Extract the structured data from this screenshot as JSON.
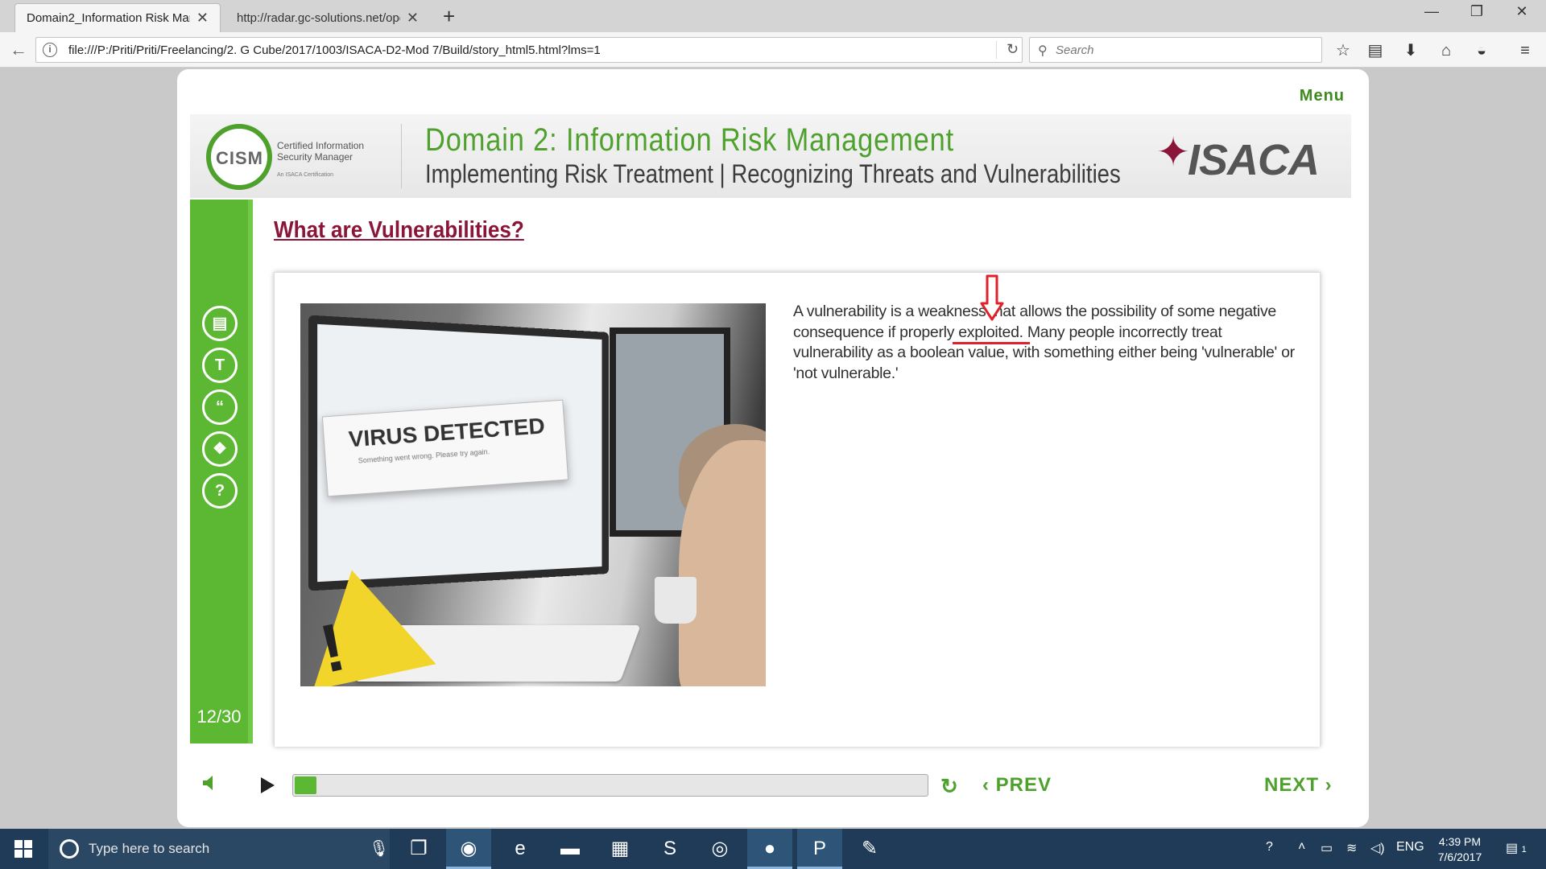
{
  "browser": {
    "tabs": [
      {
        "title": "Domain2_Information Risk Mana",
        "active": true
      },
      {
        "title": "http://radar.gc-solutions.net/ope",
        "active": false
      }
    ],
    "url": "file:///P:/Priti/Priti/Freelancing/2. G Cube/2017/1003/ISACA-D2-Mod 7/Build/story_html5.html?lms=1",
    "search_placeholder": "Search"
  },
  "course": {
    "menu_label": "Menu",
    "banner": {
      "cism_logo": "CISM",
      "cism_tagline": "Certified Information Security Manager",
      "cism_small": "An ISACA Certification",
      "title": "Domain 2: Information Risk Management",
      "subtitle": "Implementing Risk Treatment | Recognizing Threats and Vulnerabilities",
      "brand": "ISACA"
    },
    "slide_counter": "12/30",
    "heading": "What are Vulnerabilities?",
    "image": {
      "dialog_title": "VIRUS DETECTED",
      "dialog_sub": "Something went wrong. Please try again."
    },
    "body_text": "A vulnerability is a weakness that allows the possibility of some negative consequence if properly exploited.  Many people incorrectly treat vulnerability as a boolean value, with something either being 'vulnerable' or 'not vulnerable.'",
    "sidebar_icons": [
      "notes-icon",
      "transcript-icon",
      "quote-icon",
      "resources-icon",
      "help-icon"
    ],
    "player": {
      "progress": 0.035,
      "prev_label": "PREV",
      "next_label": "NEXT"
    }
  },
  "taskbar": {
    "search_placeholder": "Type here to search",
    "language": "ENG",
    "time": "4:39 PM",
    "date": "7/6/2017",
    "notification_count": "1"
  },
  "colors": {
    "accent_green": "#4fa12d",
    "heading_maroon": "#8b1538",
    "annotation_red": "#e0202a",
    "taskbar": "#1f3b57"
  }
}
